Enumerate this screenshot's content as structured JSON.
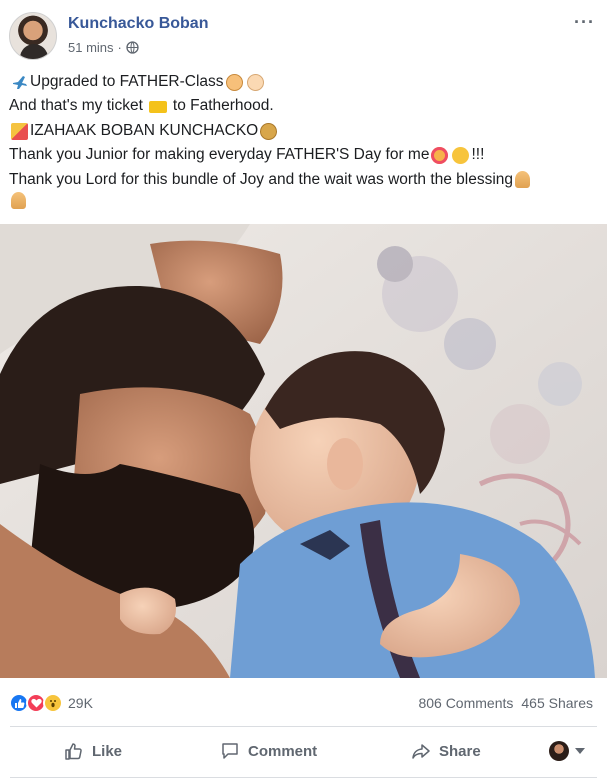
{
  "post": {
    "author": "Kunchacko Boban",
    "time": "51 mins",
    "time_separator": "·",
    "privacy_icon": "globe-icon",
    "more_icon": "ellipsis-icon",
    "more_label": "···",
    "text_lines": [
      "Upgraded to FATHER-Class",
      "And that's my ticket",
      "to Fatherhood.",
      "IZAHAAK BOBAN KUNCHACKO",
      "Thank you Junior for making everyday FATHER'S Day for me",
      "!!!",
      "Thank you Lord for this bundle of Joy and the wait was worth the blessing"
    ]
  },
  "stats": {
    "reaction_icons": [
      "like-icon",
      "love-icon",
      "wow-icon"
    ],
    "reaction_count": "29K",
    "comments": "806 Comments",
    "shares": "465 Shares"
  },
  "actions": {
    "like": "Like",
    "comment": "Comment",
    "share": "Share"
  },
  "colors": {
    "author": "#385898",
    "like_blue": "#1877f2",
    "love_red": "#f33e58",
    "wow_yellow": "#f7c43c",
    "muted_text": "#606770"
  }
}
